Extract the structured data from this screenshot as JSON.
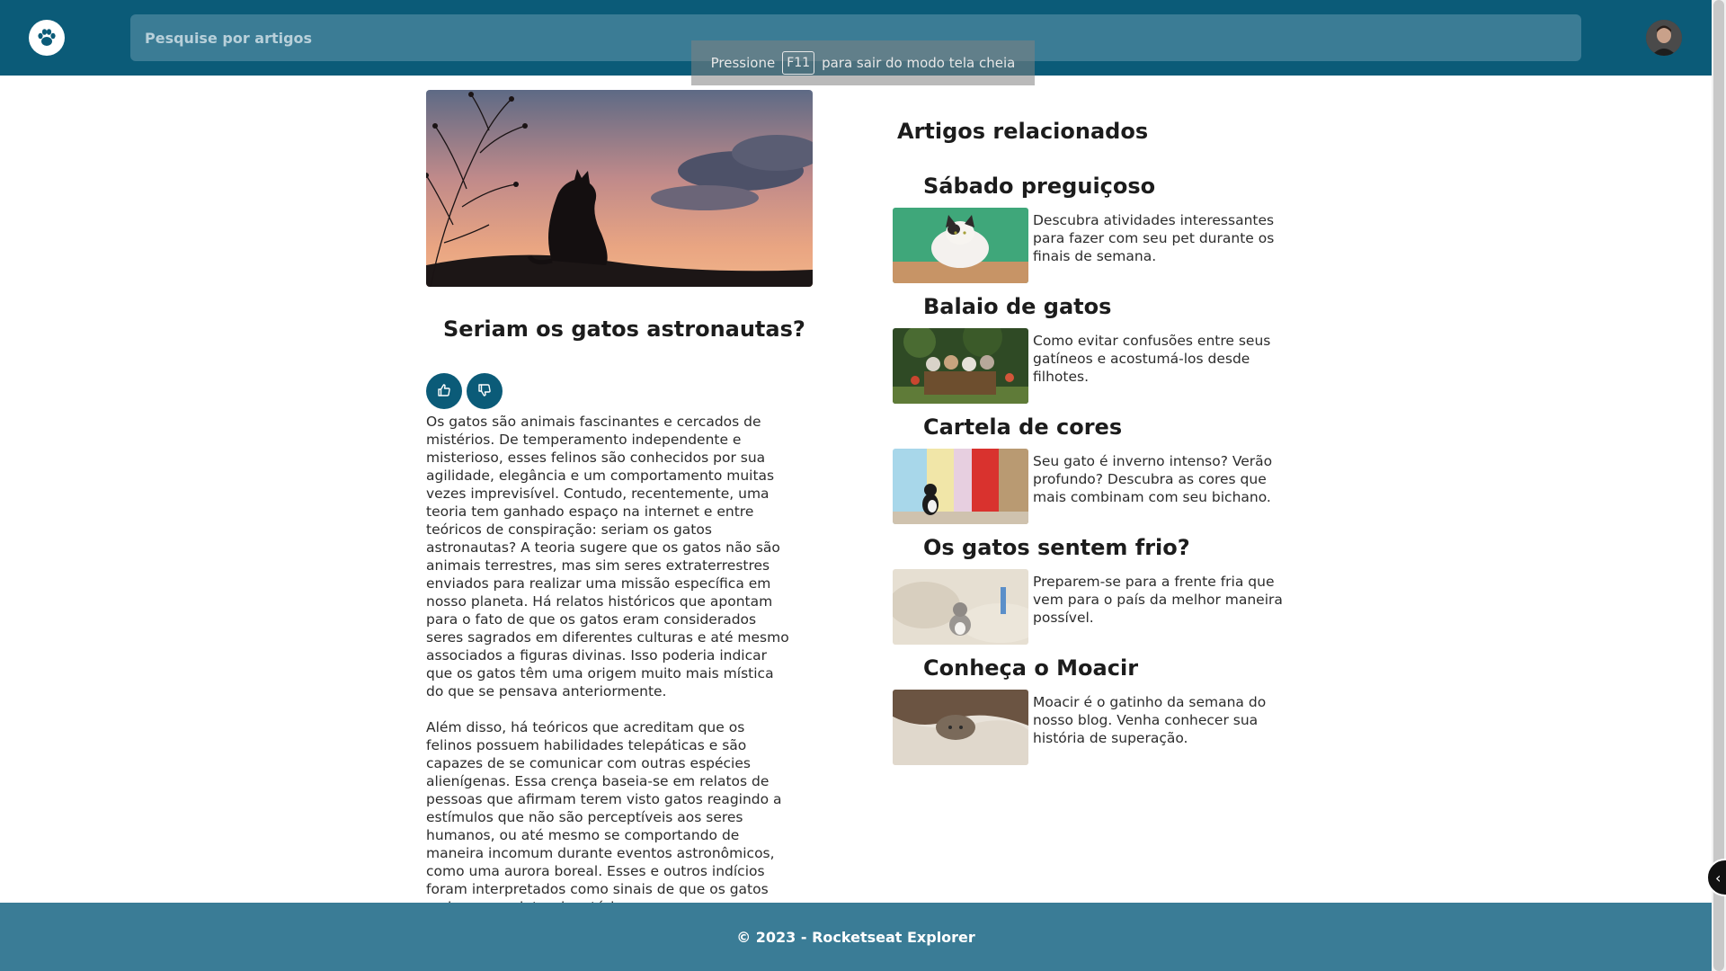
{
  "header": {
    "search_placeholder": "Pesquise por artigos",
    "logo_icon": "paw-icon",
    "avatar_icon": "user-avatar"
  },
  "toast": {
    "before": "Pressione",
    "key": "F11",
    "after": "para sair do modo tela cheia"
  },
  "article": {
    "title": "Seriam os gatos astronautas?",
    "like_icon": "thumbs-up-icon",
    "dislike_icon": "thumbs-down-icon",
    "paragraphs": [
      "Os gatos são animais fascinantes e cercados de mistérios. De temperamento independente e misterioso, esses felinos são conhecidos por sua agilidade, elegância e um comportamento muitas vezes imprevisível. Contudo, recentemente, uma teoria tem ganhado espaço na internet e entre teóricos de conspiração: seriam os gatos astronautas? A teoria sugere que os gatos não são animais terrestres, mas sim seres extraterrestres enviados para realizar uma missão específica em nosso planeta. Há relatos históricos que apontam para o fato de que os gatos eram considerados seres sagrados em diferentes culturas e até mesmo associados a figuras divinas. Isso poderia indicar que os gatos têm uma origem muito mais mística do que se pensava anteriormente.",
      "Além disso, há teóricos que acreditam que os felinos possuem habilidades telepáticas e são capazes de se comunicar com outras espécies alienígenas. Essa crença baseia-se em relatos de pessoas que afirmam terem visto gatos reagindo a estímulos que não são perceptíveis aos seres humanos, ou até mesmo se comportando de maneira incomum durante eventos astronômicos, como uma aurora boreal. Esses e outros indícios foram interpretados como sinais de que os gatos seriam seres interplanetários."
    ]
  },
  "related": {
    "heading": "Artigos relacionados",
    "items": [
      {
        "title": "Sábado preguiçoso",
        "desc": "Descubra atividades interessantes para fazer com seu pet durante os finais de semana."
      },
      {
        "title": "Balaio de gatos",
        "desc": "Como evitar confusões entre seus gatíneos e acostumá-los desde filhotes."
      },
      {
        "title": "Cartela de cores",
        "desc": "Seu gato é inverno intenso? Verão profundo? Descubra as cores que mais combinam com seu bichano."
      },
      {
        "title": "Os gatos sentem frio?",
        "desc": "Preparem-se para a frente fria que vem para o país da melhor maneira possível."
      },
      {
        "title": "Conheça o Moacir",
        "desc": "Moacir é o gatinho da semana do nosso blog. Venha conhecer sua história de superação."
      }
    ]
  },
  "footer": {
    "text": "© 2023 - Rocketseat Explorer"
  },
  "colors": {
    "header": "#0b5b78",
    "search": "#3b7c95",
    "footer": "#3a7c96",
    "button": "#0b5b78"
  }
}
